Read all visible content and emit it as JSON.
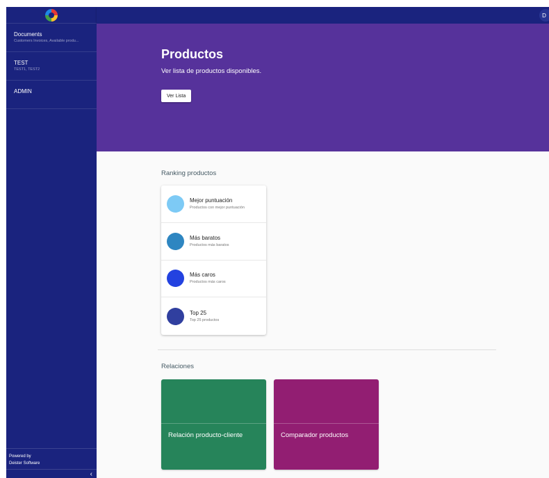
{
  "sidebar": {
    "items": [
      {
        "title": "Documents",
        "subtitle": "Customers Invoices, Available produ..."
      },
      {
        "title": "TEST",
        "subtitle": "TEST1, TEST2"
      },
      {
        "title": "ADMIN",
        "subtitle": ""
      }
    ],
    "powered_by": "Powered by",
    "company": "Deister Software",
    "collapse_glyph": "‹"
  },
  "topbar": {
    "avatar_initial": "D"
  },
  "hero": {
    "title": "Productos",
    "description": "Ver lista de productos disponibles.",
    "button_label": "Ver Lista"
  },
  "ranking": {
    "title": "Ranking productos",
    "items": [
      {
        "title": "Mejor puntuación",
        "subtitle": "Productos con mejor puntuación",
        "color": "#7dcaf5"
      },
      {
        "title": "Más baratos",
        "subtitle": "Productos más baratos",
        "color": "#2e86c1"
      },
      {
        "title": "Más caros",
        "subtitle": "Productos más caros",
        "color": "#2342e0"
      },
      {
        "title": "Top 25",
        "subtitle": "Top 25 productos",
        "color": "#303f9f"
      }
    ]
  },
  "relaciones": {
    "title": "Relaciones",
    "cards": [
      {
        "label": "Relación producto-cliente",
        "color": "#26845a"
      },
      {
        "label": "Comparador productos",
        "color": "#921e72"
      }
    ]
  },
  "colors": {
    "sidebar": "#1a237e",
    "hero": "#56329b"
  }
}
